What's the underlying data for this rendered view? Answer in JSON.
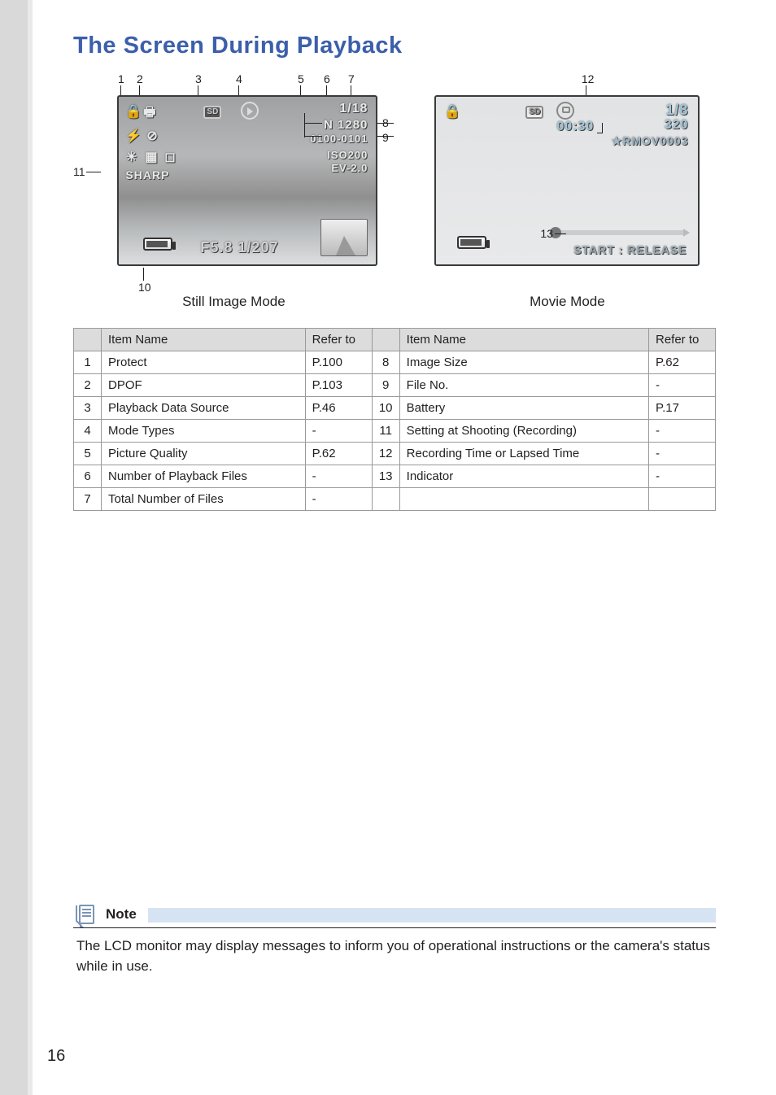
{
  "title": "The Screen During Playback",
  "diagram": {
    "still_label": "Still Image Mode",
    "movie_label": "Movie Mode",
    "callouts_top_still": [
      "1",
      "2",
      "3",
      "4",
      "5",
      "6",
      "7"
    ],
    "callouts_right_still": {
      "c8": "8",
      "c9": "9"
    },
    "callouts_left_still": {
      "c11": "11"
    },
    "callouts_bottom_still": {
      "c10": "10"
    },
    "callouts_movie": {
      "c12": "12",
      "c13": "13"
    },
    "still_osd": {
      "top_right_line1": "1/18",
      "top_right_line2": "N 1280",
      "top_right_line3": "0100-0101",
      "mid_right_line1": "ISO200",
      "mid_right_line2": "EV-2.0",
      "left_text": "SHARP",
      "bottom_center": "F5.8 1/207"
    },
    "movie_osd": {
      "top_right_frac": "1/8",
      "top_right_size": "320",
      "top_right_file": "★RMOV0003",
      "rec_time": "00:30",
      "bottom_right": "START : RELEASE"
    }
  },
  "table": {
    "headers": {
      "item": "Item Name",
      "refer": "Refer to"
    },
    "rows_left": [
      {
        "n": "1",
        "name": "Protect",
        "ref": "P.100"
      },
      {
        "n": "2",
        "name": "DPOF",
        "ref": "P.103"
      },
      {
        "n": "3",
        "name": "Playback Data Source",
        "ref": "P.46"
      },
      {
        "n": "4",
        "name": "Mode Types",
        "ref": "-"
      },
      {
        "n": "5",
        "name": "Picture Quality",
        "ref": "P.62"
      },
      {
        "n": "6",
        "name": "Number of Playback Files",
        "ref": "-"
      },
      {
        "n": "7",
        "name": "Total Number of Files",
        "ref": "-"
      }
    ],
    "rows_right": [
      {
        "n": "8",
        "name": "Image Size",
        "ref": "P.62"
      },
      {
        "n": "9",
        "name": "File No.",
        "ref": "-"
      },
      {
        "n": "10",
        "name": "Battery",
        "ref": "P.17"
      },
      {
        "n": "11",
        "name": "Setting at Shooting (Recording)",
        "ref": "-"
      },
      {
        "n": "12",
        "name": "Recording Time or Lapsed Time",
        "ref": "-"
      },
      {
        "n": "13",
        "name": "Indicator",
        "ref": "-"
      },
      {
        "n": "",
        "name": "",
        "ref": ""
      }
    ]
  },
  "note": {
    "label": "Note",
    "text": "The LCD monitor may display messages to inform you of operational instructions or the camera's status while in use."
  },
  "page_number": "16"
}
